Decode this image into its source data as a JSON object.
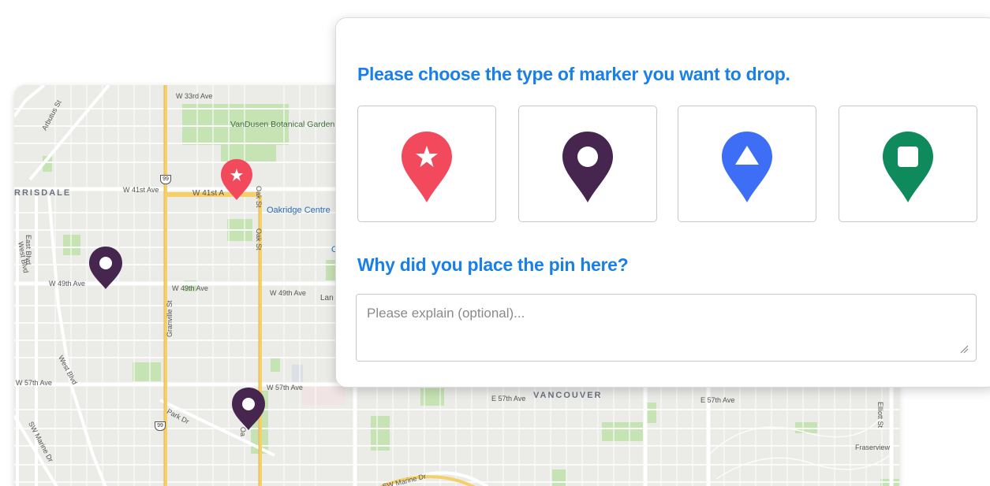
{
  "dialog": {
    "marker_question": "Please choose the type of marker you want to drop.",
    "reason_question": "Why did you place the pin here?",
    "reason_placeholder": "Please explain (optional)...",
    "marker_options": [
      {
        "name": "star",
        "color": "#f2495c",
        "icon": "star-icon"
      },
      {
        "name": "circle",
        "color": "#46264f",
        "icon": "circle-icon"
      },
      {
        "name": "triangle",
        "color": "#3d6ef5",
        "icon": "triangle-icon"
      },
      {
        "name": "square",
        "color": "#0f8a5c",
        "icon": "square-icon"
      }
    ]
  },
  "map": {
    "streets": {
      "w33": "W 33rd Ave",
      "w41a": "W 41st Ave",
      "w41b": "W 41st A",
      "w49a": "W 49th Ave",
      "w49b": "W 49th Ave",
      "w49c": "W 49th Ave",
      "w57a": "W 57th Ave",
      "w57b": "W 57th Ave",
      "e57a": "E 57th Ave",
      "e57b": "E 57th Ave",
      "arbutus": "Arbutus St",
      "eastblvd": "East Blvd",
      "westblvd": "West Blvd",
      "westblvd2": "West Blvd",
      "granville": "Granville St",
      "oak": "Oak St",
      "oak2": "Oak St",
      "oak3": "Oa",
      "parkdr": "Park Dr",
      "swmarine": "SW Marine Dr",
      "swmarine2": "SW Marine Dr",
      "elliott": "Elliott St"
    },
    "park": "VanDusen Botanical Garden",
    "poi": "Oakridge Centre",
    "poi_partial": "O",
    "lan": "Lan",
    "hood_kerrisdale": "RRISDALE",
    "hood_vancouver": "VANCOUVER",
    "fraserview": "Fraserview",
    "highway": "99",
    "pins": [
      {
        "type": "star",
        "color": "#f2495c"
      },
      {
        "type": "circle",
        "color": "#46264f"
      },
      {
        "type": "circle",
        "color": "#46264f"
      }
    ]
  }
}
